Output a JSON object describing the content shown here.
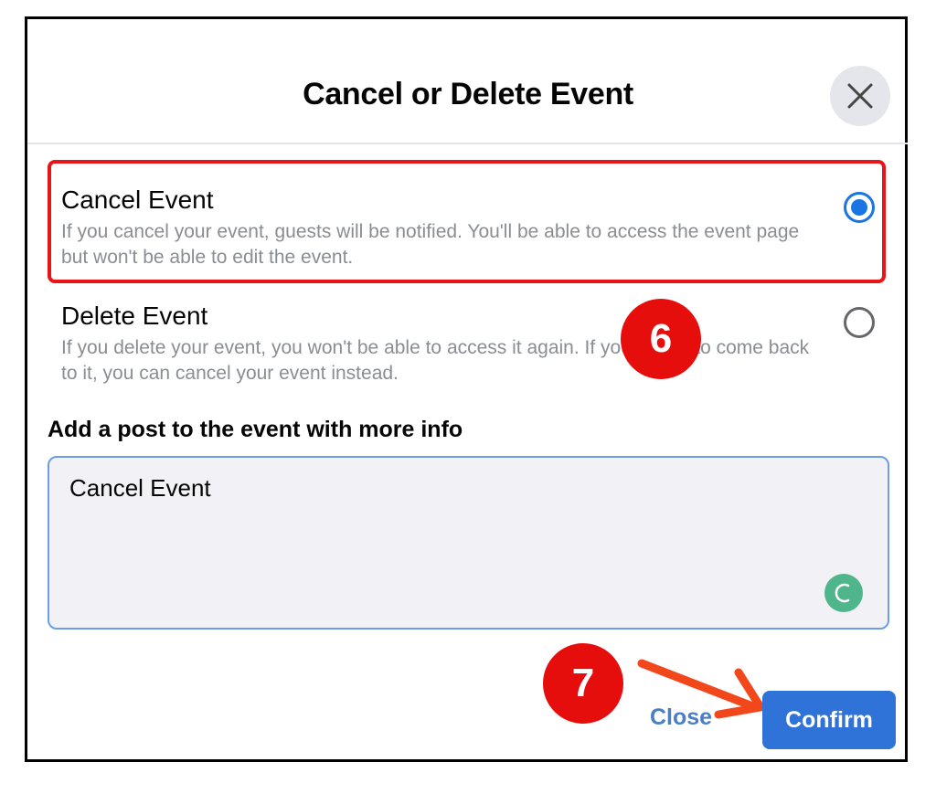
{
  "dialog": {
    "title": "Cancel or Delete Event",
    "close_icon": "close-icon"
  },
  "options": [
    {
      "title": "Cancel Event",
      "description": "If you cancel your event, guests will be notified. You'll be able to access the event page but won't be able to edit the event.",
      "selected": true
    },
    {
      "title": "Delete Event",
      "description": "If you delete your event, you won't be able to access it again. If you'll want to come back to it, you can cancel your event instead.",
      "selected": false
    }
  ],
  "post": {
    "label": "Add a post to the event with more info",
    "value": "Cancel Event",
    "assistant_icon": "grammar-assistant-icon"
  },
  "footer": {
    "close_label": "Close",
    "confirm_label": "Confirm"
  },
  "annotations": {
    "step_a": "6",
    "step_b": "7",
    "highlight_color": "#e8141a",
    "badge_color": "#e60d0d",
    "arrow_color": "#f2461b"
  },
  "colors": {
    "accent": "#1b74e4",
    "confirm_bg": "#2f72d8"
  }
}
